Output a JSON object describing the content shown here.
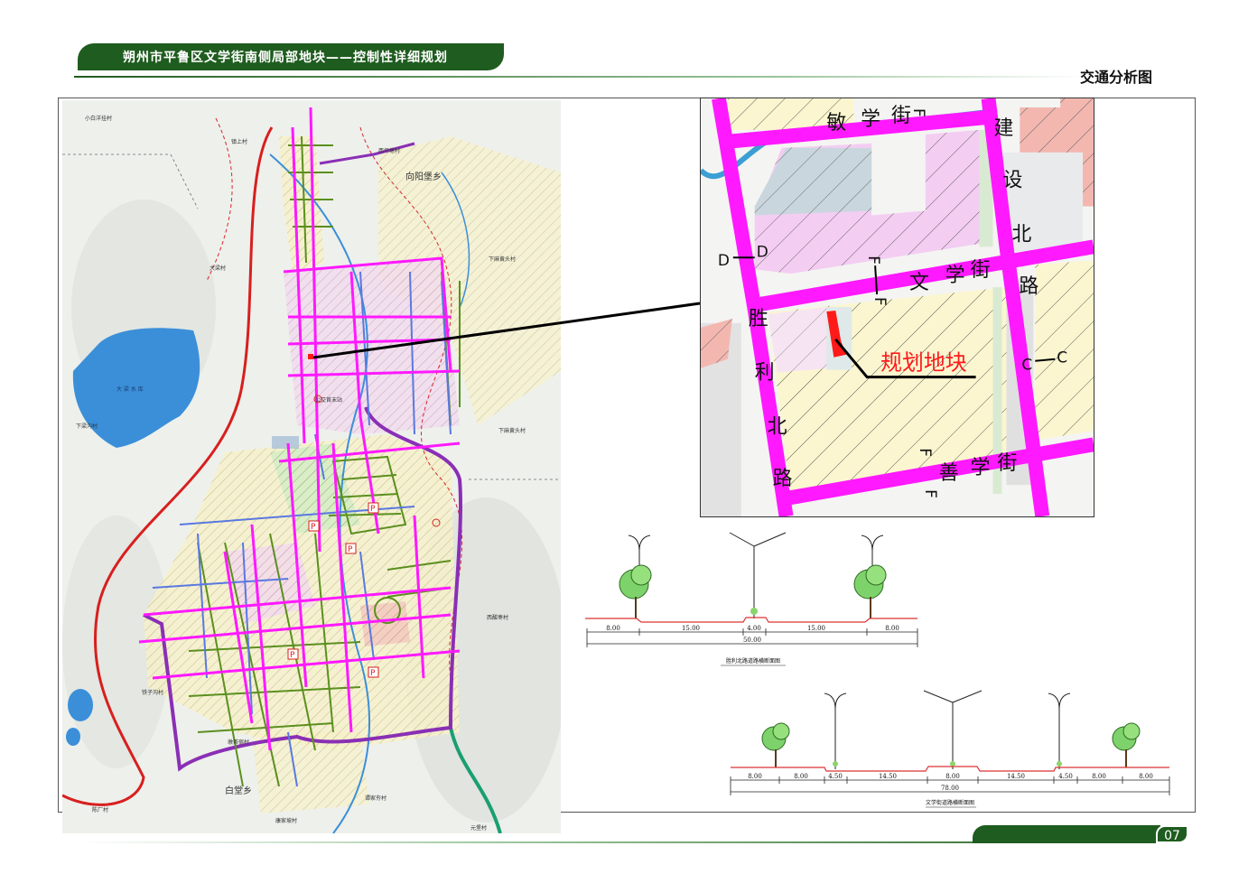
{
  "header": {
    "title": "朔州市平鲁区文学街南侧局部地块——控制性详细规划",
    "section": "交通分析图"
  },
  "page": {
    "number": "07"
  },
  "colors": {
    "brand_green": "#1f5c1f",
    "arterial_magenta": "#ff19ff",
    "highway_red": "#d81f1f",
    "ring_purple": "#8a2fb5",
    "secondary_green": "#5b8f1e",
    "branch_blue": "#5a78e0",
    "water_blue": "#3b8fd9",
    "expressway_green": "#1a9f70",
    "site_red": "#ff1a1a"
  },
  "overview_map": {
    "place_labels": [
      "小白洋挂村",
      "镇上村",
      "西坪塘村",
      "向阳堡乡",
      "下麻黄头村",
      "大梁村",
      "大 梁 水 库",
      "下梁沟村",
      "公交首末站",
      "下麻黄头村",
      "西酸枣村",
      "铁子沟村",
      "墩茶宿村",
      "白堂乡",
      "陈厂村",
      "康家坡村",
      "谭家夯村",
      "元堡村"
    ],
    "parking_symbol": "P"
  },
  "inset_map": {
    "streets": {
      "minxue": [
        "敏",
        "学",
        "街"
      ],
      "wenxue": [
        "文",
        "学",
        "街"
      ],
      "shanxue": [
        "善",
        "学",
        "街"
      ],
      "jianshe": [
        "建",
        "设",
        "北",
        "路"
      ],
      "shengli": [
        "胜",
        "利",
        "北",
        "路"
      ]
    },
    "section_marks": {
      "dd": [
        "D",
        "D"
      ],
      "cc": [
        "C",
        "C"
      ],
      "ff": "F"
    },
    "site_label": "规划地块"
  },
  "cross_section_1": {
    "caption": "胜利北路道路横断面图",
    "segments": [
      "8.00",
      "15.00",
      "4.00",
      "15.00",
      "8.00"
    ],
    "total": "50.00"
  },
  "cross_section_2": {
    "caption": "文学街道路横断面图",
    "segments": [
      "8.00",
      "8.00",
      "4.50",
      "14.50",
      "8.00",
      "14.50",
      "4.50",
      "8.00",
      "8.00"
    ],
    "total": "78.00"
  }
}
